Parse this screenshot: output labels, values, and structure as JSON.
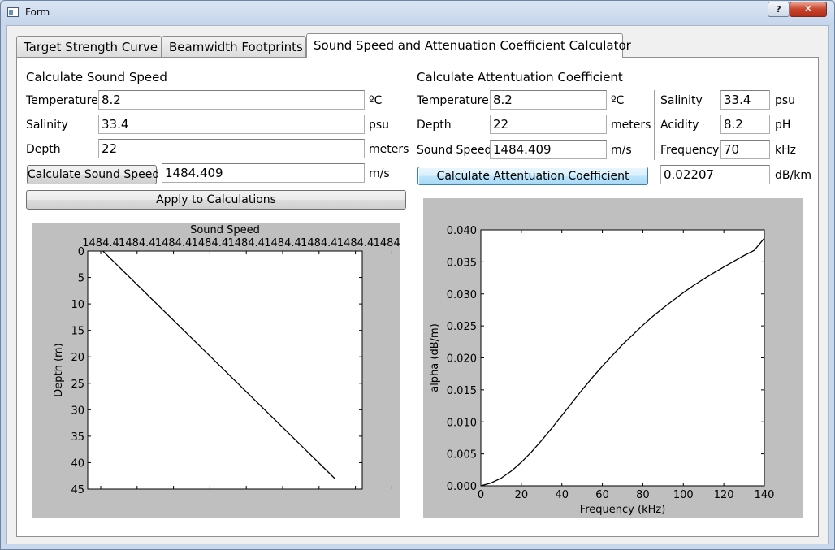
{
  "window": {
    "title": "Form",
    "help_label": "?",
    "close_label": "✕"
  },
  "tabs": [
    {
      "label": "Target Strength Curve"
    },
    {
      "label": "Beamwidth Footprints"
    },
    {
      "label": "Sound Speed and Attenuation Coefficient Calculator"
    }
  ],
  "sound_speed": {
    "heading": "Calculate Sound Speed",
    "temperature_label": "Temperature",
    "temperature_value": "8.2",
    "temperature_unit": "ºC",
    "salinity_label": "Salinity",
    "salinity_value": "33.4",
    "salinity_unit": "psu",
    "depth_label": "Depth",
    "depth_value": "22",
    "depth_unit": "meters",
    "calc_button": "Calculate Sound Speed",
    "result_value": "1484.409",
    "result_unit": "m/s",
    "apply_button": "Apply to Calculations"
  },
  "attenuation": {
    "heading": "Calculate Attentuation Coefficient",
    "temperature_label": "Temperature",
    "temperature_value": "8.2",
    "temperature_unit": "ºC",
    "depth_label": "Depth",
    "depth_value": "22",
    "depth_unit": "meters",
    "sound_speed_label": "Sound Speed",
    "sound_speed_value": "1484.409",
    "sound_speed_unit": "m/s",
    "salinity_label": "Salinity",
    "salinity_value": "33.4",
    "salinity_unit": "psu",
    "acidity_label": "Acidity",
    "acidity_value": "8.2",
    "acidity_unit": "pH",
    "frequency_label": "Frequency",
    "frequency_value": "70",
    "frequency_unit": "kHz",
    "calc_button": "Calculate Attentuation Coefficient",
    "result_value": "0.02207",
    "result_unit": "dB/km"
  },
  "chart_data": [
    {
      "type": "line",
      "title": "Sound Speed",
      "xlabel": "",
      "ylabel": "Depth (m)",
      "x_axis_position": "top",
      "y_inverted": true,
      "x_tick_labels": [
        "1484.4",
        "1484.4",
        "1484.4",
        "1484.4",
        "1484.4",
        "1484.4",
        "1484.4",
        "1484.4",
        "1484.5"
      ],
      "y_tick_labels": [
        "0",
        "5",
        "10",
        "15",
        "20",
        "25",
        "30",
        "35",
        "40",
        "45"
      ],
      "ylim": [
        0,
        45
      ],
      "series": [
        {
          "x_tick_fraction": [
            0.055,
            0.9
          ],
          "y": [
            0,
            43
          ]
        }
      ]
    },
    {
      "type": "line",
      "title": "",
      "xlabel": "Frequency (kHz)",
      "ylabel": "alpha (dB/m)",
      "xlim": [
        0,
        140
      ],
      "ylim": [
        0,
        0.04
      ],
      "x_tick_labels": [
        "0",
        "20",
        "40",
        "60",
        "80",
        "100",
        "120",
        "140"
      ],
      "y_tick_labels": [
        "0.000",
        "0.005",
        "0.010",
        "0.015",
        "0.020",
        "0.025",
        "0.030",
        "0.035",
        "0.040"
      ],
      "series": [
        {
          "x": [
            0,
            5,
            10,
            15,
            20,
            25,
            30,
            35,
            40,
            45,
            50,
            55,
            60,
            65,
            70,
            75,
            80,
            85,
            90,
            95,
            100,
            105,
            110,
            115,
            120,
            125,
            130,
            135,
            140
          ],
          "y": [
            0,
            0.00045,
            0.0012,
            0.0023,
            0.0037,
            0.0053,
            0.0071,
            0.009,
            0.011,
            0.013,
            0.015,
            0.0169,
            0.0187,
            0.0204,
            0.0221,
            0.0236,
            0.0251,
            0.0265,
            0.0278,
            0.029,
            0.0302,
            0.0313,
            0.0323,
            0.0333,
            0.0342,
            0.0351,
            0.036,
            0.0368,
            0.0387
          ]
        }
      ]
    }
  ]
}
